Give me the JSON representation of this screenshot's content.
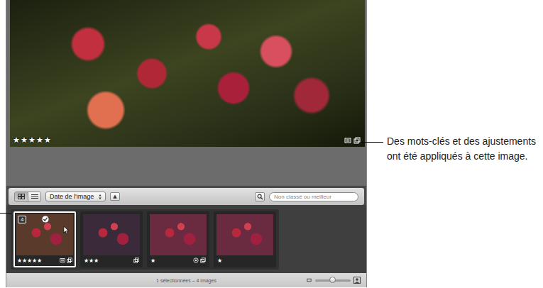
{
  "star_glyph": "★",
  "viewer": {
    "stars": 5,
    "badges": [
      "keywords",
      "adjustments"
    ]
  },
  "toolbar": {
    "view_modes": [
      {
        "kind": "grid",
        "selected": true
      },
      {
        "kind": "list",
        "selected": false
      }
    ],
    "sort": {
      "label": "Date de l'image"
    },
    "sort_direction": "▲",
    "search": {
      "placeholder": "Non classé ou meilleur"
    }
  },
  "thumbnails": [
    {
      "stars": 5,
      "selected": true,
      "stack_count": "4",
      "picked": true,
      "badges": [
        "keywords",
        "adjustments"
      ],
      "color": "#5a3a2a"
    },
    {
      "stars": 3,
      "selected": false,
      "stack_count": "",
      "picked": false,
      "badges": [
        "adjustments"
      ],
      "color": "#3a2a3a"
    },
    {
      "stars": 1,
      "selected": false,
      "stack_count": "",
      "picked": false,
      "badges": [
        "location",
        "adjustments"
      ],
      "color": "#6a2a40"
    },
    {
      "stars": 1,
      "selected": false,
      "stack_count": "",
      "picked": false,
      "badges": [],
      "color": "#6a2a40"
    }
  ],
  "status": "1 sélectionnées – 4 images",
  "zoom": {
    "level": 0.5
  },
  "callout": "Des mots-clés et des ajustements ont été appliqués à cette image."
}
